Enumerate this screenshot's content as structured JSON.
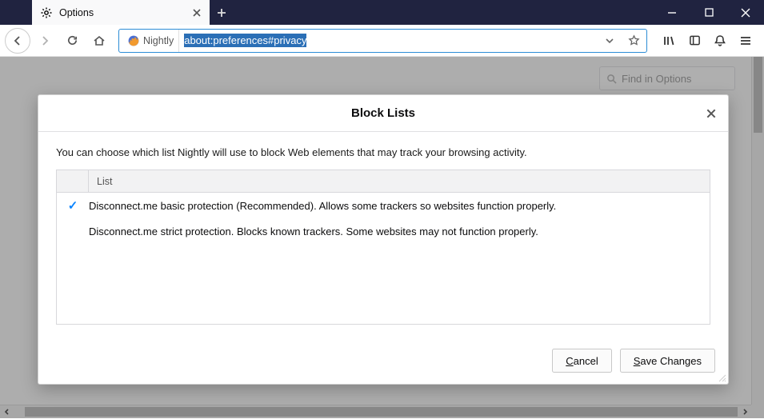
{
  "tab": {
    "title": "Options"
  },
  "url": {
    "identity_label": "Nightly",
    "value": "about:preferences#privacy"
  },
  "findbox": {
    "placeholder": "Find in Options"
  },
  "dialog": {
    "title": "Block Lists",
    "message": "You can choose which list Nightly will use to block Web elements that may track your browsing activity.",
    "list_header": "List",
    "options": [
      {
        "selected": true,
        "label": "Disconnect.me basic protection (Recommended). Allows some trackers so websites function properly."
      },
      {
        "selected": false,
        "label": "Disconnect.me strict protection. Blocks known trackers. Some websites may not function properly."
      }
    ],
    "cancel_prefix": "C",
    "cancel_rest": "ancel",
    "save_prefix": "S",
    "save_rest": "ave Changes"
  }
}
